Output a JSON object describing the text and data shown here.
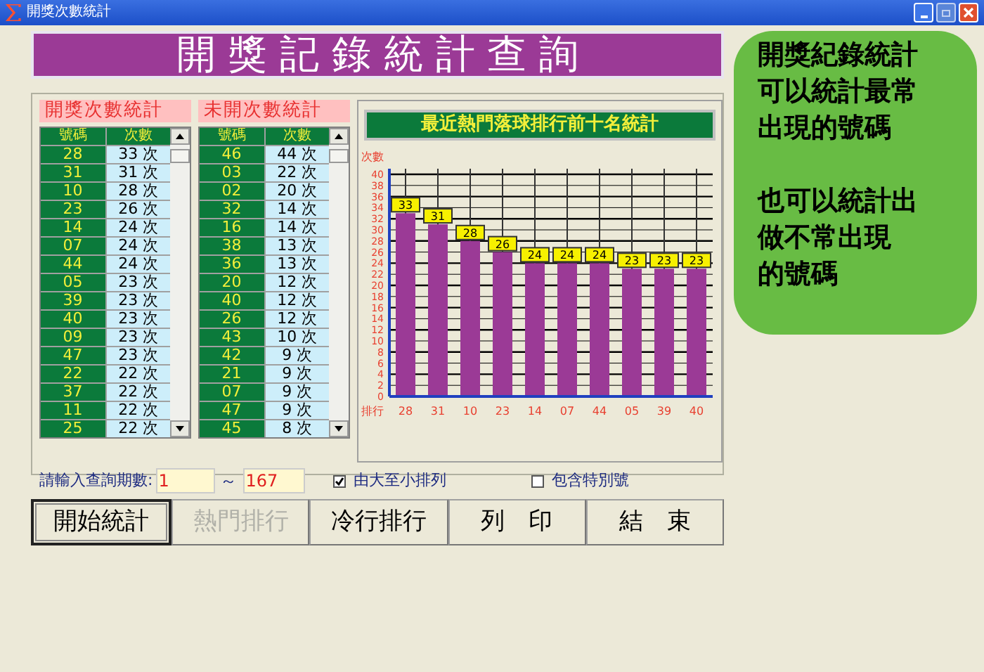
{
  "window": {
    "title": "開獎次數統計"
  },
  "banner": "開 獎 記 錄 統 計 查 詢",
  "drawn_table": {
    "title": "開獎次數統計",
    "columns": [
      "號碼",
      "次數"
    ],
    "rows": [
      [
        "28",
        "33 次"
      ],
      [
        "31",
        "31 次"
      ],
      [
        "10",
        "28 次"
      ],
      [
        "23",
        "26 次"
      ],
      [
        "14",
        "24 次"
      ],
      [
        "07",
        "24 次"
      ],
      [
        "44",
        "24 次"
      ],
      [
        "05",
        "23 次"
      ],
      [
        "39",
        "23 次"
      ],
      [
        "40",
        "23 次"
      ],
      [
        "09",
        "23 次"
      ],
      [
        "47",
        "23 次"
      ],
      [
        "22",
        "22 次"
      ],
      [
        "37",
        "22 次"
      ],
      [
        "11",
        "22 次"
      ],
      [
        "25",
        "22 次"
      ]
    ]
  },
  "undrawn_table": {
    "title": "未開次數統計",
    "columns": [
      "號碼",
      "次數"
    ],
    "rows": [
      [
        "46",
        "44 次"
      ],
      [
        "03",
        "22 次"
      ],
      [
        "02",
        "20 次"
      ],
      [
        "32",
        "14 次"
      ],
      [
        "16",
        "14 次"
      ],
      [
        "38",
        "13 次"
      ],
      [
        "36",
        "13 次"
      ],
      [
        "20",
        "12 次"
      ],
      [
        "40",
        "12 次"
      ],
      [
        "26",
        "12 次"
      ],
      [
        "43",
        "10 次"
      ],
      [
        "42",
        "9 次"
      ],
      [
        "21",
        "9 次"
      ],
      [
        "07",
        "9 次"
      ],
      [
        "47",
        "9 次"
      ],
      [
        "45",
        "8 次"
      ]
    ]
  },
  "chart": {
    "chart_data": {
      "type": "bar",
      "title": "最近熱門落球排行前十名統計",
      "xlabel": "排行",
      "ylabel": "次數",
      "categories": [
        "28",
        "31",
        "10",
        "23",
        "14",
        "07",
        "44",
        "05",
        "39",
        "40"
      ],
      "series": [
        {
          "color": "#9b3a96",
          "values": [
            33,
            31,
            28,
            26,
            24,
            24,
            24,
            23,
            23,
            23
          ]
        }
      ],
      "grid": true,
      "ylim": [
        0,
        40
      ],
      "yticks": [
        0,
        2,
        4,
        6,
        8,
        10,
        12,
        14,
        16,
        18,
        20,
        22,
        24,
        26,
        28,
        30,
        32,
        34,
        36,
        38,
        40
      ],
      "data_labels": true
    }
  },
  "period": {
    "label": "請輸入查詢期數:",
    "from": "1",
    "separator": "～",
    "to": "167"
  },
  "options": [
    {
      "label": "由大至小排列",
      "checked": true
    },
    {
      "label": "包含特別號",
      "checked": false
    }
  ],
  "buttons": [
    {
      "label": "開始統計",
      "focused": true,
      "disabled": false
    },
    {
      "label": "熱門排行",
      "focused": false,
      "disabled": true
    },
    {
      "label": "冷行排行",
      "focused": false,
      "disabled": false
    },
    {
      "label": "列　印",
      "focused": false,
      "disabled": false
    },
    {
      "label": "結　束",
      "focused": false,
      "disabled": false
    }
  ],
  "note": [
    [
      "開獎紀錄統計",
      "可以統計最常",
      "出現的號碼"
    ],
    [
      "也可以統計出",
      "做不常出現",
      "的號碼"
    ]
  ]
}
